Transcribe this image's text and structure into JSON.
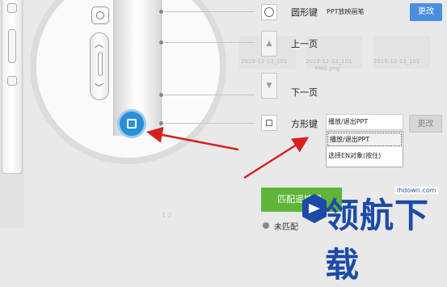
{
  "keys": {
    "circle_key_label": "圆形键",
    "circle_func": "PPT放映画笔",
    "prev_page_label": "上一页",
    "next_page_label": "下一页",
    "square_key_label": "方形键",
    "change_button": "更改",
    "change_button_disabled": "更改"
  },
  "dropdown": {
    "selected": "播放/退出PPT",
    "options": [
      "播放/退出PPT",
      "选择EN对象(按住)"
    ]
  },
  "background": {
    "thumbs": [
      "2019-12-13_101",
      "2019-12-13_101",
      "2019-12-13_101"
    ],
    "thumb_ext": "PNG.png",
    "faded_text": "1 2"
  },
  "match_button": "匹配遥控器",
  "radio_label": "未匹配",
  "watermark": {
    "url": "lhdown.com",
    "text": "领航下载"
  },
  "colors": {
    "accent_blue": "#4a8ee0",
    "highlight_blue": "#2b8fd8",
    "match_green": "#5fb53a",
    "arrow_red": "#d8211d"
  }
}
